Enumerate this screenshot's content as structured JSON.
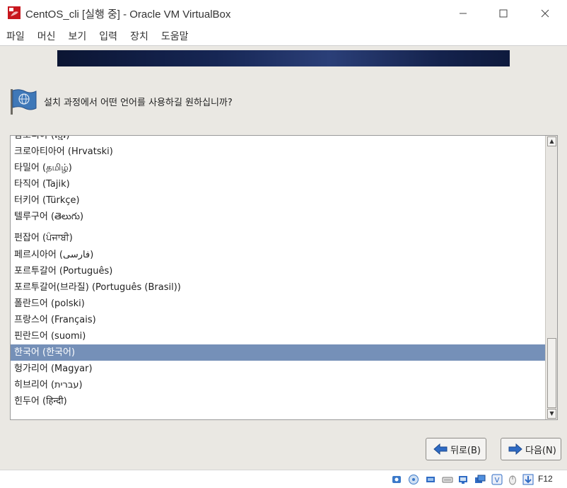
{
  "window": {
    "title": "CentOS_cli [실행 중] - Oracle VM VirtualBox",
    "minimize_glyph": "—",
    "maximize_glyph": "☐",
    "close_glyph": "✕"
  },
  "menubar": {
    "items": [
      {
        "label": "파일"
      },
      {
        "label": "머신"
      },
      {
        "label": "보기"
      },
      {
        "label": "입력"
      },
      {
        "label": "장치"
      },
      {
        "label": "도움말"
      }
    ]
  },
  "installer": {
    "prompt": "설치 과정에서 어떤 언어를 사용하길 원하십니까?",
    "languages": [
      {
        "label": "캄보디아 (ខ្មែរ)"
      },
      {
        "label": "크로아티아어  (Hrvatski)"
      },
      {
        "label": "타밀어 (தமிழ்)"
      },
      {
        "label": "타직어 (Tajik)"
      },
      {
        "label": "터키어 (Türkçe)"
      },
      {
        "label": "텔루구어 (తెలుగు)"
      },
      {
        "label": "펀잡어 (ਪੰਜਾਬੀ)"
      },
      {
        "label": "페르시아어 (فارسی)"
      },
      {
        "label": "포르투갈어 (Português)"
      },
      {
        "label": "포르투갈어(브라질) (Português (Brasil))"
      },
      {
        "label": "폴란드어 (polski)"
      },
      {
        "label": "프랑스어   (Français)"
      },
      {
        "label": "핀란드어   (suomi)"
      },
      {
        "label": "한국어 (한국어)"
      },
      {
        "label": "헝가리어   (Magyar)"
      },
      {
        "label": "히브리어   (עברית)"
      },
      {
        "label": "힌두어   (हिन्दी)"
      }
    ],
    "selected_label": "한국어 (한국어)",
    "scroll_up_glyph": "▲",
    "scroll_down_glyph": "▼",
    "back_button": "뒤로(B)",
    "next_button": "다음(N)",
    "selection_color": "#7590b8"
  },
  "statusbar": {
    "host_key": "F12",
    "icons": [
      "hard-disk-icon",
      "optical-drive-icon",
      "audio-icon",
      "network-icon",
      "usb-icon",
      "shared-folders-icon",
      "display-icon",
      "capture-icon",
      "virtualization-icon",
      "mouse-integration-icon",
      "keyboard-capture-icon"
    ]
  }
}
